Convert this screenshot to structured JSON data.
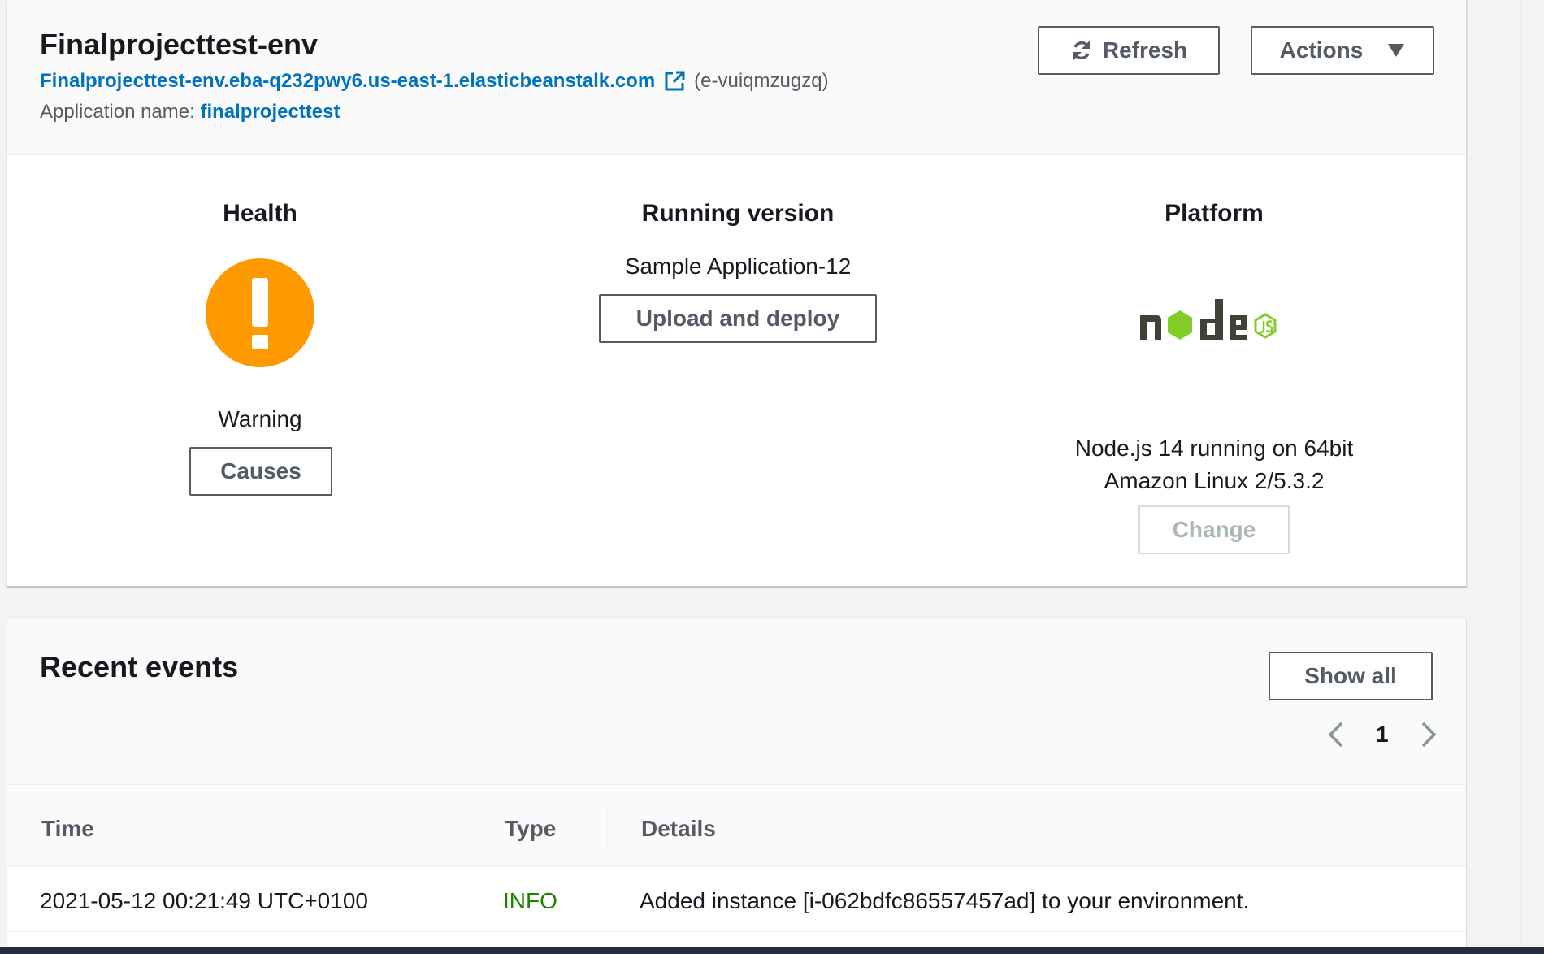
{
  "environment": {
    "name": "Finalprojecttest-env",
    "url": "Finalprojecttest-env.eba-q232pwy6.us-east-1.elasticbeanstalk.com",
    "env_id": "(e-vuiqmzugzq)",
    "app_name_label": "Application name:",
    "app_name": "finalprojecttest"
  },
  "toolbar": {
    "refresh_label": "Refresh",
    "actions_label": "Actions"
  },
  "health": {
    "title": "Health",
    "status": "Warning",
    "status_color": "#ff9900",
    "causes_label": "Causes"
  },
  "running_version": {
    "title": "Running version",
    "version": "Sample Application-12",
    "upload_label": "Upload and deploy"
  },
  "platform": {
    "title": "Platform",
    "logo": "nodejs-logo",
    "description_line1": "Node.js 14 running on 64bit",
    "description_line2": "Amazon Linux 2/5.3.2",
    "change_label": "Change"
  },
  "recent_events": {
    "title": "Recent events",
    "show_all_label": "Show all",
    "page": "1",
    "columns": [
      "Time",
      "Type",
      "Details"
    ],
    "rows": [
      {
        "time": "2021-05-12 00:21:49 UTC+0100",
        "type": "INFO",
        "details": "Added instance [i-062bdfc86557457ad] to your environment."
      }
    ]
  },
  "colors": {
    "link": "#0073bb",
    "info": "#1d8102",
    "node_green": "#83cd29",
    "node_dark": "#404137"
  }
}
